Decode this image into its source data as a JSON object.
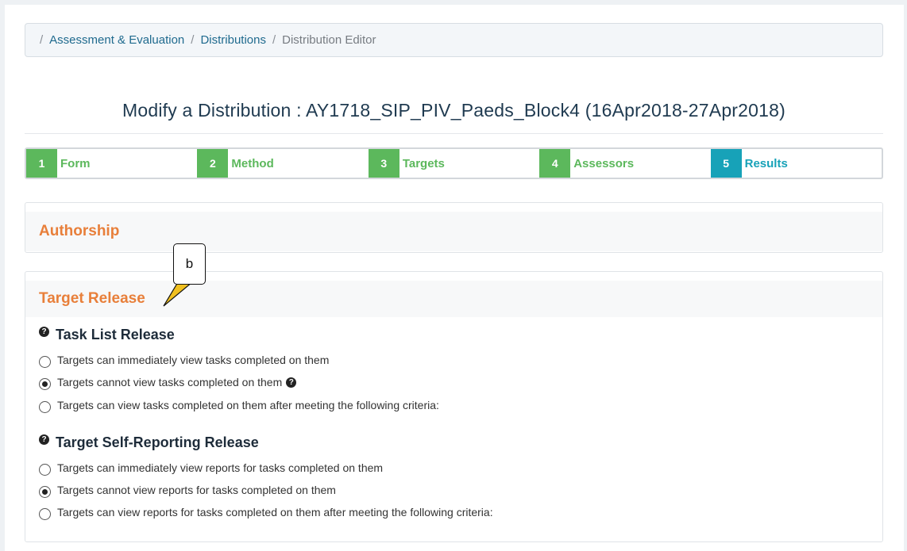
{
  "breadcrumb": {
    "items": [
      "Assessment & Evaluation",
      "Distributions"
    ],
    "current": "Distribution Editor"
  },
  "title": "Modify a Distribution : AY1718_SIP_PIV_Paeds_Block4 (16Apr2018-27Apr2018)",
  "steps": [
    {
      "num": "1",
      "label": "Form"
    },
    {
      "num": "2",
      "label": "Method"
    },
    {
      "num": "3",
      "label": "Targets"
    },
    {
      "num": "4",
      "label": "Assessors"
    },
    {
      "num": "5",
      "label": "Results",
      "active": true
    }
  ],
  "authorship": {
    "heading": "Authorship"
  },
  "callout": "b",
  "target_release": {
    "heading": "Target Release",
    "task_list": {
      "heading": "Task List Release",
      "help_icon": "question-circle-icon",
      "options": [
        {
          "label": "Targets can immediately view tasks completed on them",
          "checked": false
        },
        {
          "label": "Targets cannot view tasks completed on them",
          "checked": true,
          "help": true
        },
        {
          "label": "Targets can view tasks completed on them after meeting the following criteria:",
          "checked": false
        }
      ]
    },
    "self_reporting": {
      "heading": "Target Self-Reporting Release",
      "help_icon": "question-circle-icon",
      "options": [
        {
          "label": "Targets can immediately view reports for tasks completed on them",
          "checked": false
        },
        {
          "label": "Targets cannot view reports for tasks completed on them",
          "checked": true
        },
        {
          "label": "Targets can view reports for tasks completed on them after meeting the following criteria:",
          "checked": false
        }
      ]
    }
  },
  "colors": {
    "accent_orange": "#e87f3a",
    "step_green": "#5cb85c",
    "step_active": "#17a2b8",
    "link": "#1f6a8e"
  }
}
